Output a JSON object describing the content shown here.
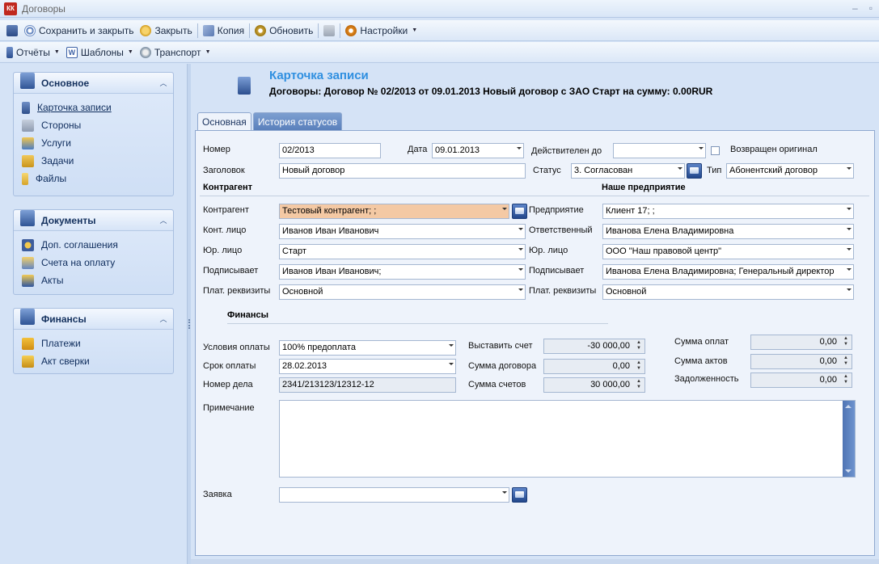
{
  "window": {
    "title": "Договоры",
    "logo": "КК"
  },
  "toolbar1": {
    "save_close": "Сохранить и закрыть",
    "close": "Закрыть",
    "copy": "Копия",
    "refresh": "Обновить",
    "settings": "Настройки"
  },
  "toolbar2": {
    "reports": "Отчёты",
    "templates": "Шаблоны",
    "transport": "Транспорт"
  },
  "nav": {
    "main": {
      "title": "Основное",
      "items": [
        "Карточка записи",
        "Стороны",
        "Услуги",
        "Задачи",
        "Файлы"
      ]
    },
    "documents": {
      "title": "Документы",
      "items": [
        "Доп. соглашения",
        "Счета на оплату",
        "Акты"
      ]
    },
    "finance": {
      "title": "Финансы",
      "items": [
        "Платежи",
        "Акт сверки"
      ]
    }
  },
  "card": {
    "title": "Карточка записи",
    "subtitle": "Договоры: Договор № 02/2013 от 09.01.2013 Новый договор с ЗАО Старт на сумму: 0.00RUR"
  },
  "tabs": [
    "Основная",
    "История статусов"
  ],
  "form": {
    "labels": {
      "number": "Номер",
      "date": "Дата",
      "valid_until": "Действителен до",
      "original_returned": "Возвращен оригинал",
      "heading": "Заголовок",
      "status": "Статус",
      "type": "Тип",
      "counterparty_section": "Контрагент",
      "our_company_section": "Наше предприятие",
      "counterparty": "Контрагент",
      "contact": "Конт. лицо",
      "legal_entity": "Юр. лицо",
      "signer": "Подписывает",
      "payment_details": "Плат. реквизиты",
      "enterprise": "Предприятие",
      "responsible": "Ответственный",
      "finance_section": "Финансы",
      "payment_terms": "Условия оплаты",
      "payment_due": "Срок оплаты",
      "case_number": "Номер дела",
      "issue_invoice": "Выставить счет",
      "contract_sum": "Сумма договора",
      "invoices_sum": "Сумма счетов",
      "payments_sum": "Сумма оплат",
      "acts_sum": "Сумма актов",
      "debt": "Задолженность",
      "note": "Примечание",
      "request": "Заявка"
    },
    "values": {
      "number": "02/2013",
      "date": "09.01.2013",
      "valid_until": "",
      "heading": "Новый договор",
      "status": "3. Согласован",
      "type": "Абонентский договор",
      "counterparty": "Тестовый контрагент; ;",
      "contact": "Иванов Иван Иванович",
      "legal_entity": "Старт",
      "signer": "Иванов Иван Иванович;",
      "payment_details": "Основной",
      "enterprise": "Клиент 17; ;",
      "responsible": "Иванова Елена Владимировна",
      "our_legal_entity": "ООО \"Наш правовой центр\"",
      "our_signer": "Иванова Елена Владимировна; Генеральный директор",
      "our_payment_details": "Основной",
      "payment_terms": "100% предоплата",
      "payment_due": "28.02.2013",
      "case_number": "2341/213123/12312-12",
      "issue_invoice": "-30 000,00",
      "contract_sum": "0,00",
      "invoices_sum": "30 000,00",
      "payments_sum": "0,00",
      "acts_sum": "0,00",
      "debt": "0,00",
      "note": "",
      "request": ""
    }
  }
}
